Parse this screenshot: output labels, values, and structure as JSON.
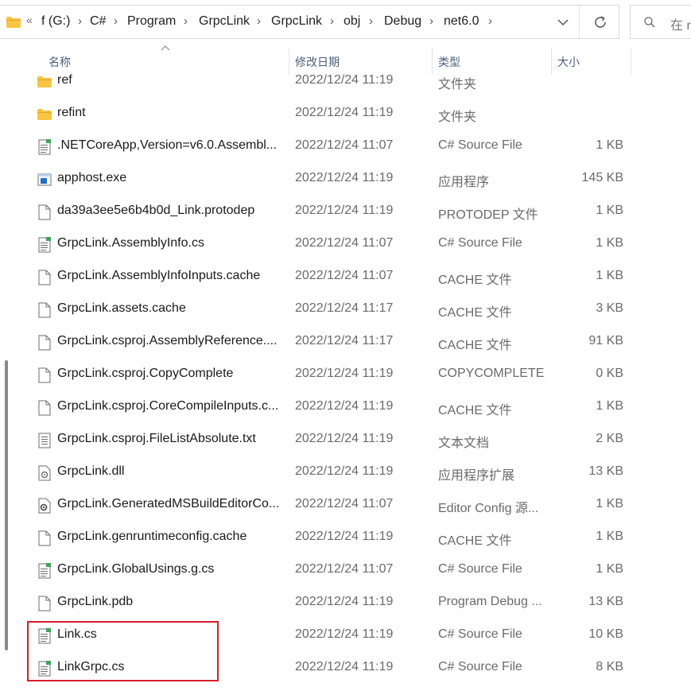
{
  "addressbar": {
    "overflow": "«",
    "crumbs": [
      "f (G:)",
      "C#",
      "Program",
      "GrpcLink",
      "GrpcLink",
      "obj",
      "Debug",
      "net6.0"
    ],
    "separator": "›"
  },
  "search": {
    "placeholder": "在 n"
  },
  "columns": {
    "name": "名称",
    "date": "修改日期",
    "type": "类型",
    "size": "大小"
  },
  "files": [
    {
      "name": "ref",
      "date": "2022/12/24 11:19",
      "type": "文件夹",
      "size": "",
      "icon": "folder-icon"
    },
    {
      "name": "refint",
      "date": "2022/12/24 11:19",
      "type": "文件夹",
      "size": "",
      "icon": "folder-icon"
    },
    {
      "name": ".NETCoreApp,Version=v6.0.Assembl...",
      "date": "2022/12/24 11:07",
      "type": "C# Source File",
      "size": "1 KB",
      "icon": "csharp-file-icon"
    },
    {
      "name": "apphost.exe",
      "date": "2022/12/24 11:19",
      "type": "应用程序",
      "size": "145 KB",
      "icon": "exe-icon"
    },
    {
      "name": "da39a3ee5e6b4b0d_Link.protodep",
      "date": "2022/12/24 11:19",
      "type": "PROTODEP 文件",
      "size": "1 KB",
      "icon": "file-icon"
    },
    {
      "name": "GrpcLink.AssemblyInfo.cs",
      "date": "2022/12/24 11:07",
      "type": "C# Source File",
      "size": "1 KB",
      "icon": "csharp-file-icon"
    },
    {
      "name": "GrpcLink.AssemblyInfoInputs.cache",
      "date": "2022/12/24 11:07",
      "type": "CACHE 文件",
      "size": "1 KB",
      "icon": "file-icon"
    },
    {
      "name": "GrpcLink.assets.cache",
      "date": "2022/12/24 11:17",
      "type": "CACHE 文件",
      "size": "3 KB",
      "icon": "file-icon"
    },
    {
      "name": "GrpcLink.csproj.AssemblyReference....",
      "date": "2022/12/24 11:17",
      "type": "CACHE 文件",
      "size": "91 KB",
      "icon": "file-icon"
    },
    {
      "name": "GrpcLink.csproj.CopyComplete",
      "date": "2022/12/24 11:19",
      "type": "COPYCOMPLETE...",
      "size": "0 KB",
      "icon": "file-icon"
    },
    {
      "name": "GrpcLink.csproj.CoreCompileInputs.c...",
      "date": "2022/12/24 11:19",
      "type": "CACHE 文件",
      "size": "1 KB",
      "icon": "file-icon"
    },
    {
      "name": "GrpcLink.csproj.FileListAbsolute.txt",
      "date": "2022/12/24 11:19",
      "type": "文本文档",
      "size": "2 KB",
      "icon": "text-file-icon"
    },
    {
      "name": "GrpcLink.dll",
      "date": "2022/12/24 11:19",
      "type": "应用程序扩展",
      "size": "13 KB",
      "icon": "dll-icon"
    },
    {
      "name": "GrpcLink.GeneratedMSBuildEditorCo...",
      "date": "2022/12/24 11:07",
      "type": "Editor Config 源...",
      "size": "1 KB",
      "icon": "config-file-icon"
    },
    {
      "name": "GrpcLink.genruntimeconfig.cache",
      "date": "2022/12/24 11:19",
      "type": "CACHE 文件",
      "size": "1 KB",
      "icon": "file-icon"
    },
    {
      "name": "GrpcLink.GlobalUsings.g.cs",
      "date": "2022/12/24 11:07",
      "type": "C# Source File",
      "size": "1 KB",
      "icon": "csharp-file-icon"
    },
    {
      "name": "GrpcLink.pdb",
      "date": "2022/12/24 11:19",
      "type": "Program Debug ...",
      "size": "13 KB",
      "icon": "file-icon"
    },
    {
      "name": "Link.cs",
      "date": "2022/12/24 11:19",
      "type": "C# Source File",
      "size": "10 KB",
      "icon": "csharp-file-icon"
    },
    {
      "name": "LinkGrpc.cs",
      "date": "2022/12/24 11:19",
      "type": "C# Source File",
      "size": "8 KB",
      "icon": "csharp-file-icon"
    }
  ],
  "colors": {
    "header_text": "#4c607a",
    "highlight_border": "#d0202e",
    "folder": "#f8c444"
  }
}
